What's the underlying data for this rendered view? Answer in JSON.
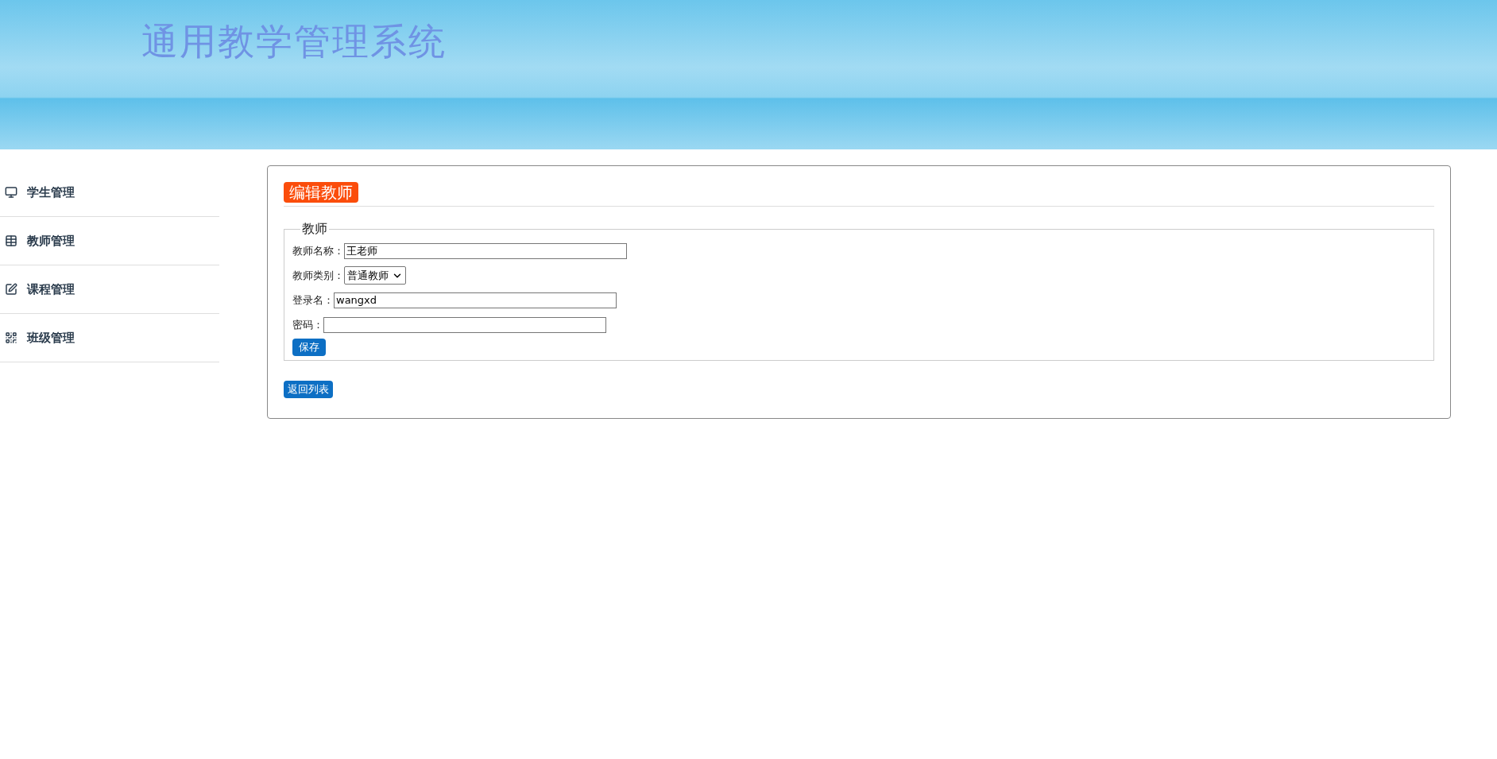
{
  "header": {
    "title": "通用教学管理系统"
  },
  "sidebar": {
    "items": [
      {
        "label": "学生管理"
      },
      {
        "label": "教师管理"
      },
      {
        "label": "课程管理"
      },
      {
        "label": "班级管理"
      }
    ]
  },
  "panel": {
    "title": "编辑教师",
    "fieldset": {
      "legend": "教师",
      "fields": [
        {
          "kind": "text",
          "label": "教师名称：",
          "value": "王老师"
        },
        {
          "kind": "select",
          "label": "教师类别：",
          "value": "普通教师"
        },
        {
          "kind": "text",
          "label": "登录名：",
          "value": "wangxd"
        },
        {
          "kind": "password",
          "label": "密码："
        }
      ],
      "submit": "保存"
    },
    "back_button": "返回列表"
  }
}
